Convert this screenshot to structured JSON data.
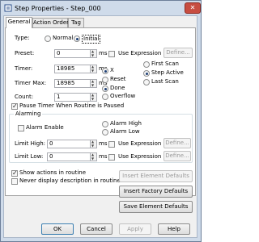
{
  "window": {
    "title": "Step Properties - Step_000",
    "close_glyph": "✕",
    "icon": "step-icon"
  },
  "tabs": [
    {
      "label": "General",
      "active": true
    },
    {
      "label": "Action Order",
      "active": false
    },
    {
      "label": "Tag",
      "active": false
    }
  ],
  "general": {
    "type_label": "Type:",
    "type_options": [
      {
        "label": "Normal",
        "selected": false
      },
      {
        "label": "Initial",
        "selected": true
      }
    ],
    "preset": {
      "label": "Preset:",
      "value": "0",
      "unit": "ms",
      "use_expression": "Use Expression",
      "define": "Define..."
    },
    "timer": {
      "label": "Timer:",
      "value": "18985",
      "unit": "ms"
    },
    "timer_max": {
      "label": "Timer Max:",
      "value": "18985",
      "unit": "ms"
    },
    "count": {
      "label": "Count:",
      "value": "1"
    },
    "status_col1": [
      {
        "label": "X",
        "selected": true
      },
      {
        "label": "Reset",
        "selected": false
      },
      {
        "label": "Done",
        "selected": true
      },
      {
        "label": "Overflow",
        "selected": false
      }
    ],
    "status_col2": [
      {
        "label": "First Scan",
        "selected": false
      },
      {
        "label": "Step Active",
        "selected": true
      },
      {
        "label": "Last Scan",
        "selected": false
      }
    ],
    "pause_timer": {
      "label": "Pause Timer When Routine is Paused",
      "checked": true
    },
    "alarming": {
      "title": "Alarming",
      "alarm_enable": {
        "label": "Alarm Enable",
        "checked": false
      },
      "alarm_high": "Alarm High",
      "alarm_low": "Alarm Low",
      "limit_high": {
        "label": "Limit High:",
        "value": "0",
        "unit": "ms",
        "use_expression": "Use Expression",
        "define": "Define..."
      },
      "limit_low": {
        "label": "Limit Low:",
        "value": "0",
        "unit": "ms",
        "use_expression": "Use Expression",
        "define": "Define..."
      }
    }
  },
  "show_actions": {
    "label": "Show actions in routine",
    "checked": true
  },
  "never_display": {
    "label": "Never display description in routine",
    "checked": false
  },
  "defaults": {
    "insert_element": "Insert Element Defaults",
    "insert_factory": "Insert Factory Defaults",
    "save_element": "Save Element Defaults"
  },
  "footer": {
    "ok": "OK",
    "cancel": "Cancel",
    "apply": "Apply",
    "help": "Help"
  }
}
